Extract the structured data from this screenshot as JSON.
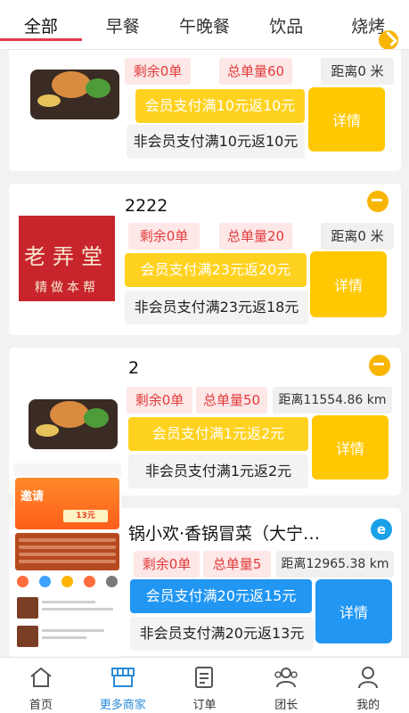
{
  "tabs": [
    {
      "label": "全部",
      "active": true
    },
    {
      "label": "早餐"
    },
    {
      "label": "午晚餐"
    },
    {
      "label": "饮品"
    },
    {
      "label": "烧烤"
    }
  ],
  "cards": [
    {
      "name": "",
      "remaining": "剩余0单",
      "total": "总单量60",
      "distance": "距离0 米",
      "member_offer": "会员支付满10元返10元",
      "nonmember_offer": "非会员支付满10元返10元",
      "detail": "详情",
      "icon": "arrow-icon"
    },
    {
      "name": "2222",
      "remaining": "剩余0单",
      "total": "总单量20",
      "distance": "距离0 米",
      "member_offer": "会员支付满23元返20元",
      "nonmember_offer": "非会员支付满23元返18元",
      "detail": "详情",
      "icon": "arrow-icon",
      "logo_text": "老弄堂",
      "logo_sub": "精做本帮"
    },
    {
      "name": "2",
      "remaining": "剩余0单",
      "total": "总单量50",
      "distance": "距离11554.86 km",
      "member_offer": "会员支付满1元返2元",
      "nonmember_offer": "非会员支付满1元返2元",
      "detail": "详情",
      "icon": "arrow-icon"
    },
    {
      "name": "锅小欢·香锅冒菜（大宁…",
      "remaining": "剩余0单",
      "total": "总单量5",
      "distance": "距离12965.38 km",
      "member_offer": "会员支付满20元返15元",
      "nonmember_offer": "非会员支付满20元返13元",
      "detail": "详情",
      "icon": "e-icon",
      "promo_title": "邀请",
      "promo_price": "13元"
    }
  ],
  "nav": [
    {
      "label": "首页",
      "icon": "home-icon"
    },
    {
      "label": "更多商家",
      "icon": "store-icon",
      "active": true
    },
    {
      "label": "订单",
      "icon": "order-icon"
    },
    {
      "label": "团长",
      "icon": "team-icon"
    },
    {
      "label": "我的",
      "icon": "profile-icon"
    }
  ],
  "colors": {
    "accent_red": "#e63a4a",
    "yellow": "#ffd21f",
    "blue": "#2196f3",
    "nav_active": "#2a8ad8"
  }
}
